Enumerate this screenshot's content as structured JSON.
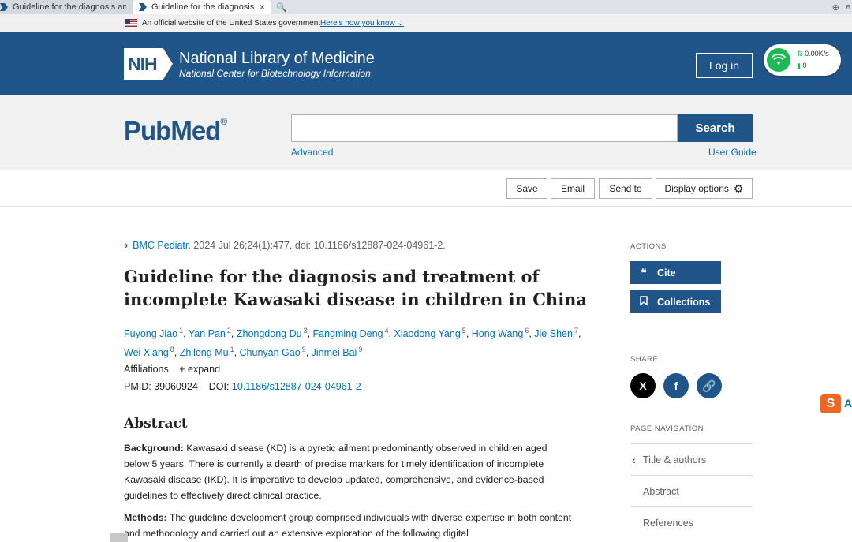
{
  "browser": {
    "tabs": [
      {
        "label": "Guideline for the diagnosis and"
      },
      {
        "label": "Guideline for the diagnosis",
        "close": "×"
      }
    ],
    "search_glyph": "🔍",
    "download_glyph": "⊕",
    "overflow_label": "e"
  },
  "gov_banner": {
    "text": "An official website of the United States government",
    "link": "Here's how you know"
  },
  "header": {
    "nih_mark": "NIH",
    "title": "National Library of Medicine",
    "subtitle": "National Center for Biotechnology Information",
    "login": "Log in",
    "net_speed": "0.00K/s",
    "net_count": "0"
  },
  "search": {
    "logo_pub": "Pub",
    "logo_med": "Med",
    "logo_reg": "®",
    "query": "",
    "button": "Search",
    "advanced": "Advanced",
    "user_guide": "User Guide"
  },
  "toolbar": {
    "save": "Save",
    "email": "Email",
    "send_to": "Send to",
    "display_options": "Display options"
  },
  "article": {
    "journal": "BMC Pediatr.",
    "citation": "2024 Jul 26;24(1):477. doi: 10.1186/s12887-024-04961-2.",
    "title": "Guideline for the diagnosis and treatment of incomplete Kawasaki disease in children in China",
    "authors": [
      {
        "name": "Fuyong Jiao",
        "sup": "1"
      },
      {
        "name": "Yan Pan",
        "sup": "2"
      },
      {
        "name": "Zhongdong Du",
        "sup": "3"
      },
      {
        "name": "Fangming Deng",
        "sup": "4"
      },
      {
        "name": "Xiaodong Yang",
        "sup": "5"
      },
      {
        "name": "Hong Wang",
        "sup": "6"
      },
      {
        "name": "Jie Shen",
        "sup": "7"
      },
      {
        "name": "Wei Xiang",
        "sup": "8"
      },
      {
        "name": "Zhilong Mu",
        "sup": "1"
      },
      {
        "name": "Chunyan Gao",
        "sup": "9"
      },
      {
        "name": "Jinmei Bai",
        "sup": "9"
      }
    ],
    "affiliations": "Affiliations",
    "expand": "+ expand",
    "pmid_label": "PMID: 39060924",
    "doi_label": "DOI:",
    "doi": "10.1186/s12887-024-04961-2",
    "abstract_heading": "Abstract",
    "background_label": "Background:",
    "background_text": "Kawasaki disease (KD) is a pyretic ailment predominantly observed in children aged below 5 years. There is currently a dearth of precise markers for timely identification of incomplete Kawasaki disease (IKD). It is imperative to develop updated, comprehensive, and evidence-based guidelines to effectively direct clinical practice.",
    "methods_label": "Methods:",
    "methods_text": "The guideline development group comprised individuals with diverse expertise in both content and methodology and carried out an extensive exploration of the following digital"
  },
  "sidebar": {
    "actions_label": "ACTIONS",
    "cite": "Cite",
    "collections": "Collections",
    "share_label": "SHARE",
    "share": [
      {
        "glyph": "X",
        "color": "#000000"
      },
      {
        "glyph": "f",
        "color": "#20558a"
      },
      {
        "glyph": "🔗",
        "color": "#20558a"
      }
    ],
    "nav_label": "PAGE NAVIGATION",
    "nav": [
      "Title & authors",
      "Abstract",
      "References"
    ]
  },
  "sogou": {
    "s": "S",
    "a": "A"
  }
}
